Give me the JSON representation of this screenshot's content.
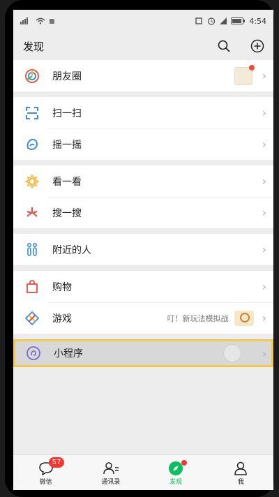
{
  "status": {
    "time": "4:54"
  },
  "header": {
    "title": "发现"
  },
  "groups": [
    [
      {
        "id": "moments",
        "label": "朋友圈",
        "icon": "moments-icon"
      }
    ],
    [
      {
        "id": "scan",
        "label": "扫一扫",
        "icon": "scan-icon"
      },
      {
        "id": "shake",
        "label": "摇一摇",
        "icon": "shake-icon"
      }
    ],
    [
      {
        "id": "look",
        "label": "看一看",
        "icon": "look-icon"
      },
      {
        "id": "search",
        "label": "搜一搜",
        "icon": "search-sparkle-icon"
      }
    ],
    [
      {
        "id": "nearby",
        "label": "附近的人",
        "icon": "people-nearby-icon"
      }
    ],
    [
      {
        "id": "shopping",
        "label": "购物",
        "icon": "shopping-bag-icon"
      },
      {
        "id": "games",
        "label": "游戏",
        "icon": "game-diamond-icon",
        "extra": "叮！新玩法模拟战"
      }
    ],
    [
      {
        "id": "miniprogram",
        "label": "小程序",
        "icon": "mini-program-icon"
      }
    ]
  ],
  "tabs": [
    {
      "label": "微信",
      "badge": "57"
    },
    {
      "label": "通讯录"
    },
    {
      "label": "发现"
    },
    {
      "label": "我"
    }
  ]
}
